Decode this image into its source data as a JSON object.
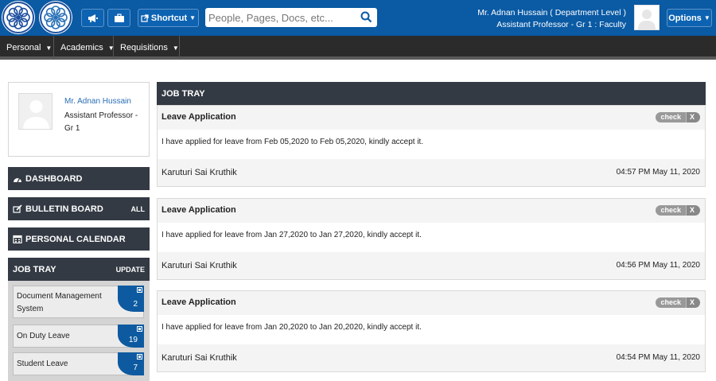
{
  "topbar": {
    "logo_left": "university-logo",
    "logo_right": "university-logo",
    "announce_icon": "megaphone-icon",
    "briefcase_icon": "briefcase-icon",
    "shortcut_label": "Shortcut",
    "search_placeholder": "People, Pages, Docs, etc...",
    "user_name": "Mr. Adnan Hussain ( Department Level )",
    "user_role": "Assistant Professor - Gr 1 : Faculty",
    "options_label": "Options",
    "brand_color": "#0a5aa4"
  },
  "nav": {
    "items": [
      {
        "label": "Personal"
      },
      {
        "label": "Academics"
      },
      {
        "label": "Requisitions"
      }
    ]
  },
  "profile": {
    "name": "Mr. Adnan Hussain",
    "title": "Assistant Professor - Gr 1"
  },
  "sidebar": {
    "dashboard": "DASHBOARD",
    "bulletin": "BULLETIN BOARD",
    "bulletin_right": "ALL",
    "calendar": "PERSONAL CALENDAR",
    "jobtray": "JOB TRAY",
    "jobtray_right": "UPDATE",
    "jobtray_items": [
      {
        "label": "Document Management System",
        "count": "2"
      },
      {
        "label": "On Duty Leave",
        "count": "19"
      },
      {
        "label": "Student Leave",
        "count": "7"
      }
    ]
  },
  "main": {
    "header": "JOB TRAY",
    "cards": [
      {
        "title": "Leave Application",
        "check": "check",
        "close": "X",
        "body": "I have applied for leave from Feb 05,2020 to Feb 05,2020, kindly accept it.",
        "sender": "Karuturi Sai Kruthik",
        "time": "04:57 PM May 11, 2020"
      },
      {
        "title": "Leave Application",
        "check": "check",
        "close": "X",
        "body": "I have applied for leave from Jan 27,2020 to Jan 27,2020, kindly accept it.",
        "sender": "Karuturi Sai Kruthik",
        "time": "04:56 PM May 11, 2020"
      },
      {
        "title": "Leave Application",
        "check": "check",
        "close": "X",
        "body": "I have applied for leave from Jan 20,2020 to Jan 20,2020, kindly accept it.",
        "sender": "Karuturi Sai Kruthik",
        "time": "04:54 PM May 11, 2020"
      }
    ]
  }
}
